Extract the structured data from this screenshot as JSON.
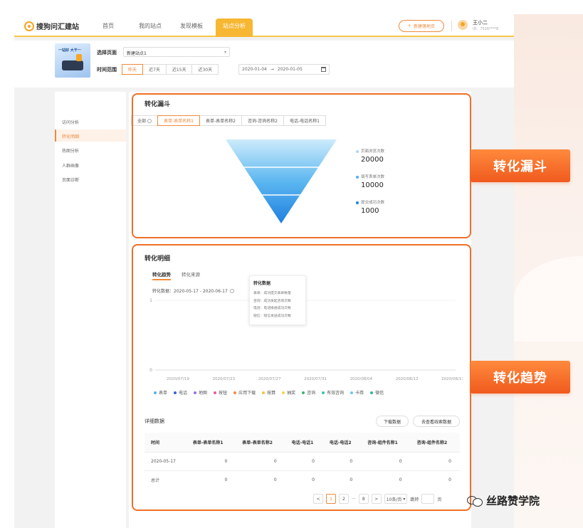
{
  "brand": {
    "logo_text": "搜狗问汇建站"
  },
  "nav": {
    "items": [
      {
        "label": "首页"
      },
      {
        "label": "我的站点"
      },
      {
        "label": "发现模板"
      },
      {
        "label": "站点分析"
      }
    ],
    "new_page_label": "新建落地页",
    "user_name": "王小二",
    "user_id": "ID：7526****8"
  },
  "selector": {
    "page_label": "选择页面",
    "page_value": "新建站点1",
    "time_label": "时间范围",
    "time_options": [
      "昨天",
      "近7天",
      "近15天",
      "近30天"
    ],
    "date_start": "2020-01-04",
    "date_sep": "→",
    "date_end": "2020-01-05"
  },
  "thumb": {
    "title": "一站好 大干一"
  },
  "sidebar": {
    "items": [
      {
        "label": "访问分析"
      },
      {
        "label": "转化明细"
      },
      {
        "label": "热图分析"
      },
      {
        "label": "人群画像"
      },
      {
        "label": "页面诊断"
      }
    ]
  },
  "funnel": {
    "title": "转化漏斗",
    "tabs": [
      "全部",
      "表单-表单名称1",
      "表单-表单名称2",
      "咨询-咨询名称2",
      "电话-电话名称1"
    ],
    "legend": [
      {
        "label": "页面浏览次数",
        "value": "20000",
        "color": "#a9d8f7"
      },
      {
        "label": "填写表单次数",
        "value": "10000",
        "color": "#4fb1ef"
      },
      {
        "label": "提交成功次数",
        "value": "1000",
        "color": "#1f7fe0"
      }
    ]
  },
  "trend": {
    "title": "转化明细",
    "tabs": [
      "转化趋势",
      "转化来源"
    ],
    "data_range_label": "转化数据：2020-05-17 - 2020-06-17",
    "tooltip": {
      "title": "转化数据",
      "lines": [
        "表单：成功提交表单数量",
        "咨询：成功发起咨询次数",
        "电话：电话接通成功次数",
        "短信：短信发送成功次数"
      ]
    },
    "series": [
      {
        "name": "表单",
        "color": "#4fb1ef"
      },
      {
        "name": "电话",
        "color": "#3a5fd9"
      },
      {
        "name": "地图",
        "color": "#9b6ee0"
      },
      {
        "name": "按钮",
        "color": "#e65a9a"
      },
      {
        "name": "应用下载",
        "color": "#f08b3c"
      },
      {
        "name": "按算",
        "color": "#f5c242"
      },
      {
        "name": "抽奖",
        "color": "#f5d34a"
      },
      {
        "name": "咨询",
        "color": "#3ab86b"
      },
      {
        "name": "有效咨询",
        "color": "#39c3b4"
      },
      {
        "name": "卡券",
        "color": "#6fc6ee"
      },
      {
        "name": "微信",
        "color": "#2fb5a8"
      }
    ]
  },
  "chart_data": {
    "type": "line",
    "x": [
      "2020/07/19",
      "2020/07/23",
      "2020/07/27",
      "2020/07/31",
      "2020/08/04",
      "2020/08/12",
      "2020/08/17"
    ],
    "ylim": [
      0,
      1
    ],
    "y_ticks": [
      "1",
      "0"
    ],
    "series": []
  },
  "detail": {
    "title": "详细数据",
    "download_label": "下载数据",
    "clue_label": "去查看线索数据",
    "columns": [
      "时间",
      "表单-表单名称1",
      "表单-表单名称2",
      "电话-电话1",
      "电话-电话2",
      "咨询-组件名称1",
      "咨询-组件名称2"
    ],
    "rows": [
      [
        "2020-05-17",
        "0",
        "0",
        "0",
        "0",
        "0",
        "0"
      ],
      [
        "总计",
        "0",
        "0",
        "0",
        "0",
        "0",
        "0"
      ]
    ]
  },
  "pager": {
    "prev": "<",
    "pages": [
      "1",
      "2",
      "···",
      "8"
    ],
    "next": ">",
    "page_size": "10条/页",
    "jump_label": "跳转",
    "page_unit": "页"
  },
  "callouts": {
    "funnel": "转化漏斗",
    "trend": "转化趋势"
  },
  "watermark": {
    "text": "丝路赞学院"
  }
}
